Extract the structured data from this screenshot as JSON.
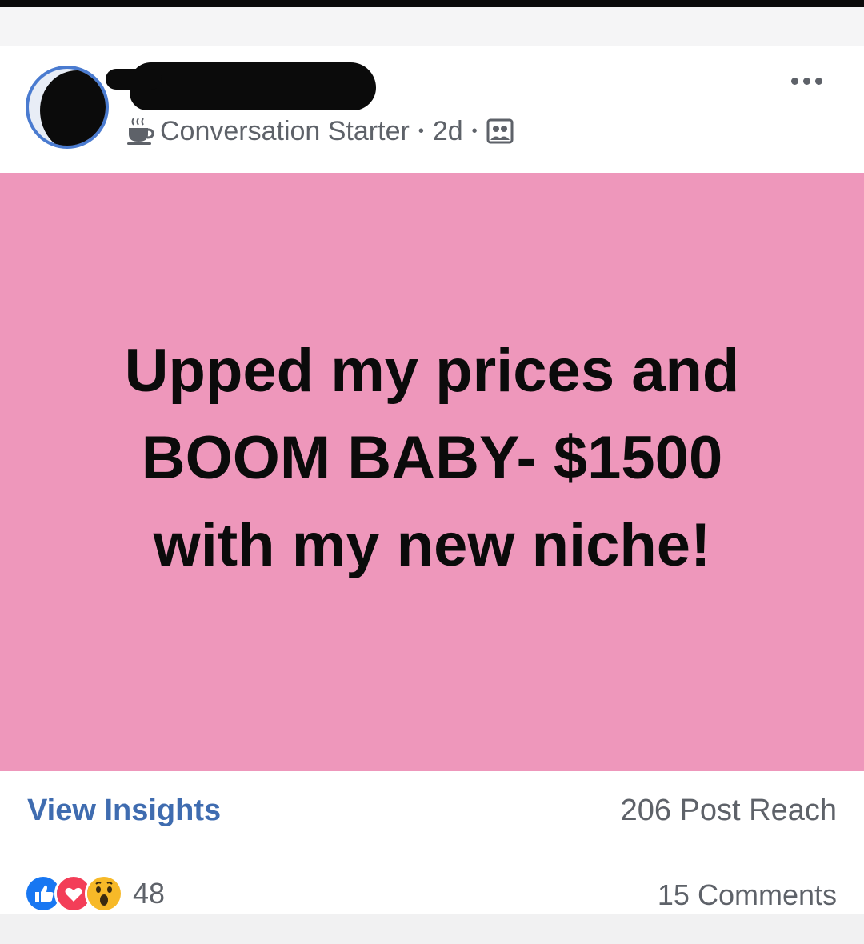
{
  "post": {
    "group_badge": "Conversation Starter",
    "separator": "•",
    "time": "2d",
    "text_line1": "Upped my prices and",
    "text_line2": "BOOM BABY- $1500",
    "text_line3": "with my new niche!",
    "background_color": "#ee97bb"
  },
  "insights": {
    "view_label": "View Insights",
    "reach": "206 Post Reach"
  },
  "engagement": {
    "reactions": [
      "like-icon",
      "love-icon",
      "wow-icon"
    ],
    "reaction_count": "48",
    "comments": "15 Comments"
  },
  "colors": {
    "link": "#3f6cb0",
    "secondary_text": "#5e6269",
    "like_blue": "#1877f2",
    "love_red": "#f33e58",
    "wow_yellow": "#f7b928"
  }
}
